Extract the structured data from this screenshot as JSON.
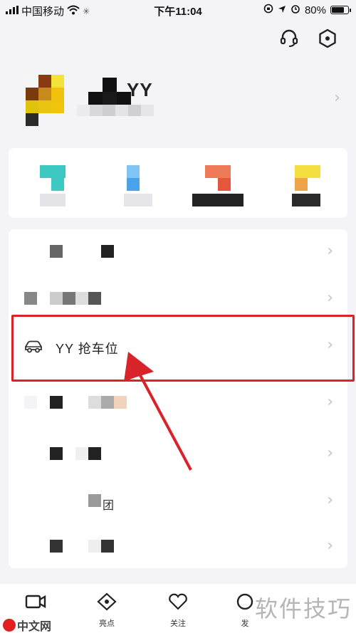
{
  "status_bar": {
    "carrier": "中国移动",
    "time": "下午11:04",
    "battery": "80%",
    "battery_level": 0.8
  },
  "profile": {
    "name_suffix": "YY"
  },
  "menu": {
    "highlighted_item": "YY 抢车位",
    "partial_suffix": "团"
  },
  "tabs": [
    {
      "label": "",
      "icon": "video-camera-icon"
    },
    {
      "label": "亮点",
      "icon": "eye-icon"
    },
    {
      "label": "关注",
      "icon": "heart-icon"
    },
    {
      "label": "发",
      "icon": "publish-icon"
    }
  ],
  "watermark": {
    "text": "软件技巧",
    "logo_text": "中文网"
  },
  "colors": {
    "highlight": "#d9232a",
    "chevron": "#c4c4c8",
    "card": "#ffffff",
    "background": "#f4f4f6"
  }
}
